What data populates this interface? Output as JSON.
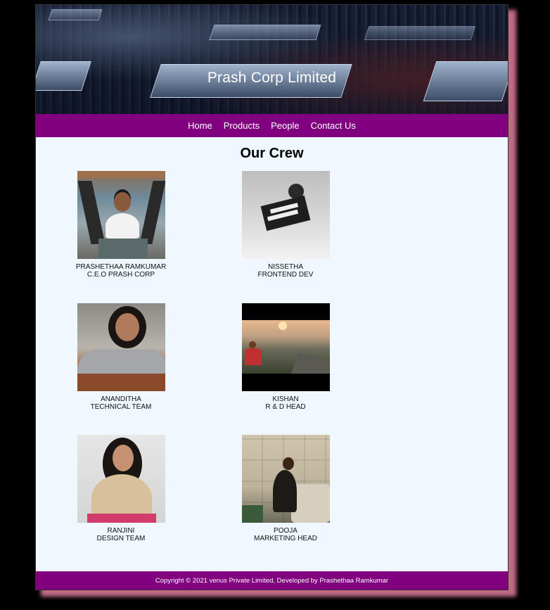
{
  "header": {
    "title": "Prash Corp Limited"
  },
  "nav": {
    "items": [
      "Home",
      "Products",
      "People",
      "Contact Us"
    ]
  },
  "main": {
    "heading": "Our Crew",
    "members": [
      {
        "name": "PRASHETHAA RAMKUMAR",
        "role": "C.E.O PRASH CORP"
      },
      {
        "name": "NISSETHA",
        "role": "FRONTEND DEV"
      },
      {
        "name": "ANANDITHA",
        "role": "TECHNICAL TEAM"
      },
      {
        "name": "KISHAN",
        "role": "R & D HEAD"
      },
      {
        "name": "RANJINI",
        "role": "DESIGN TEAM"
      },
      {
        "name": "POOJA",
        "role": "MARKETING HEAD"
      }
    ]
  },
  "footer": {
    "text": "Copyright © 2021 venus Private Limited, Developed by Prashethaa Ramkumar"
  },
  "colors": {
    "nav_bg": "#800080",
    "page_bg": "#f0f8ff",
    "shadow": "#c06a84"
  }
}
